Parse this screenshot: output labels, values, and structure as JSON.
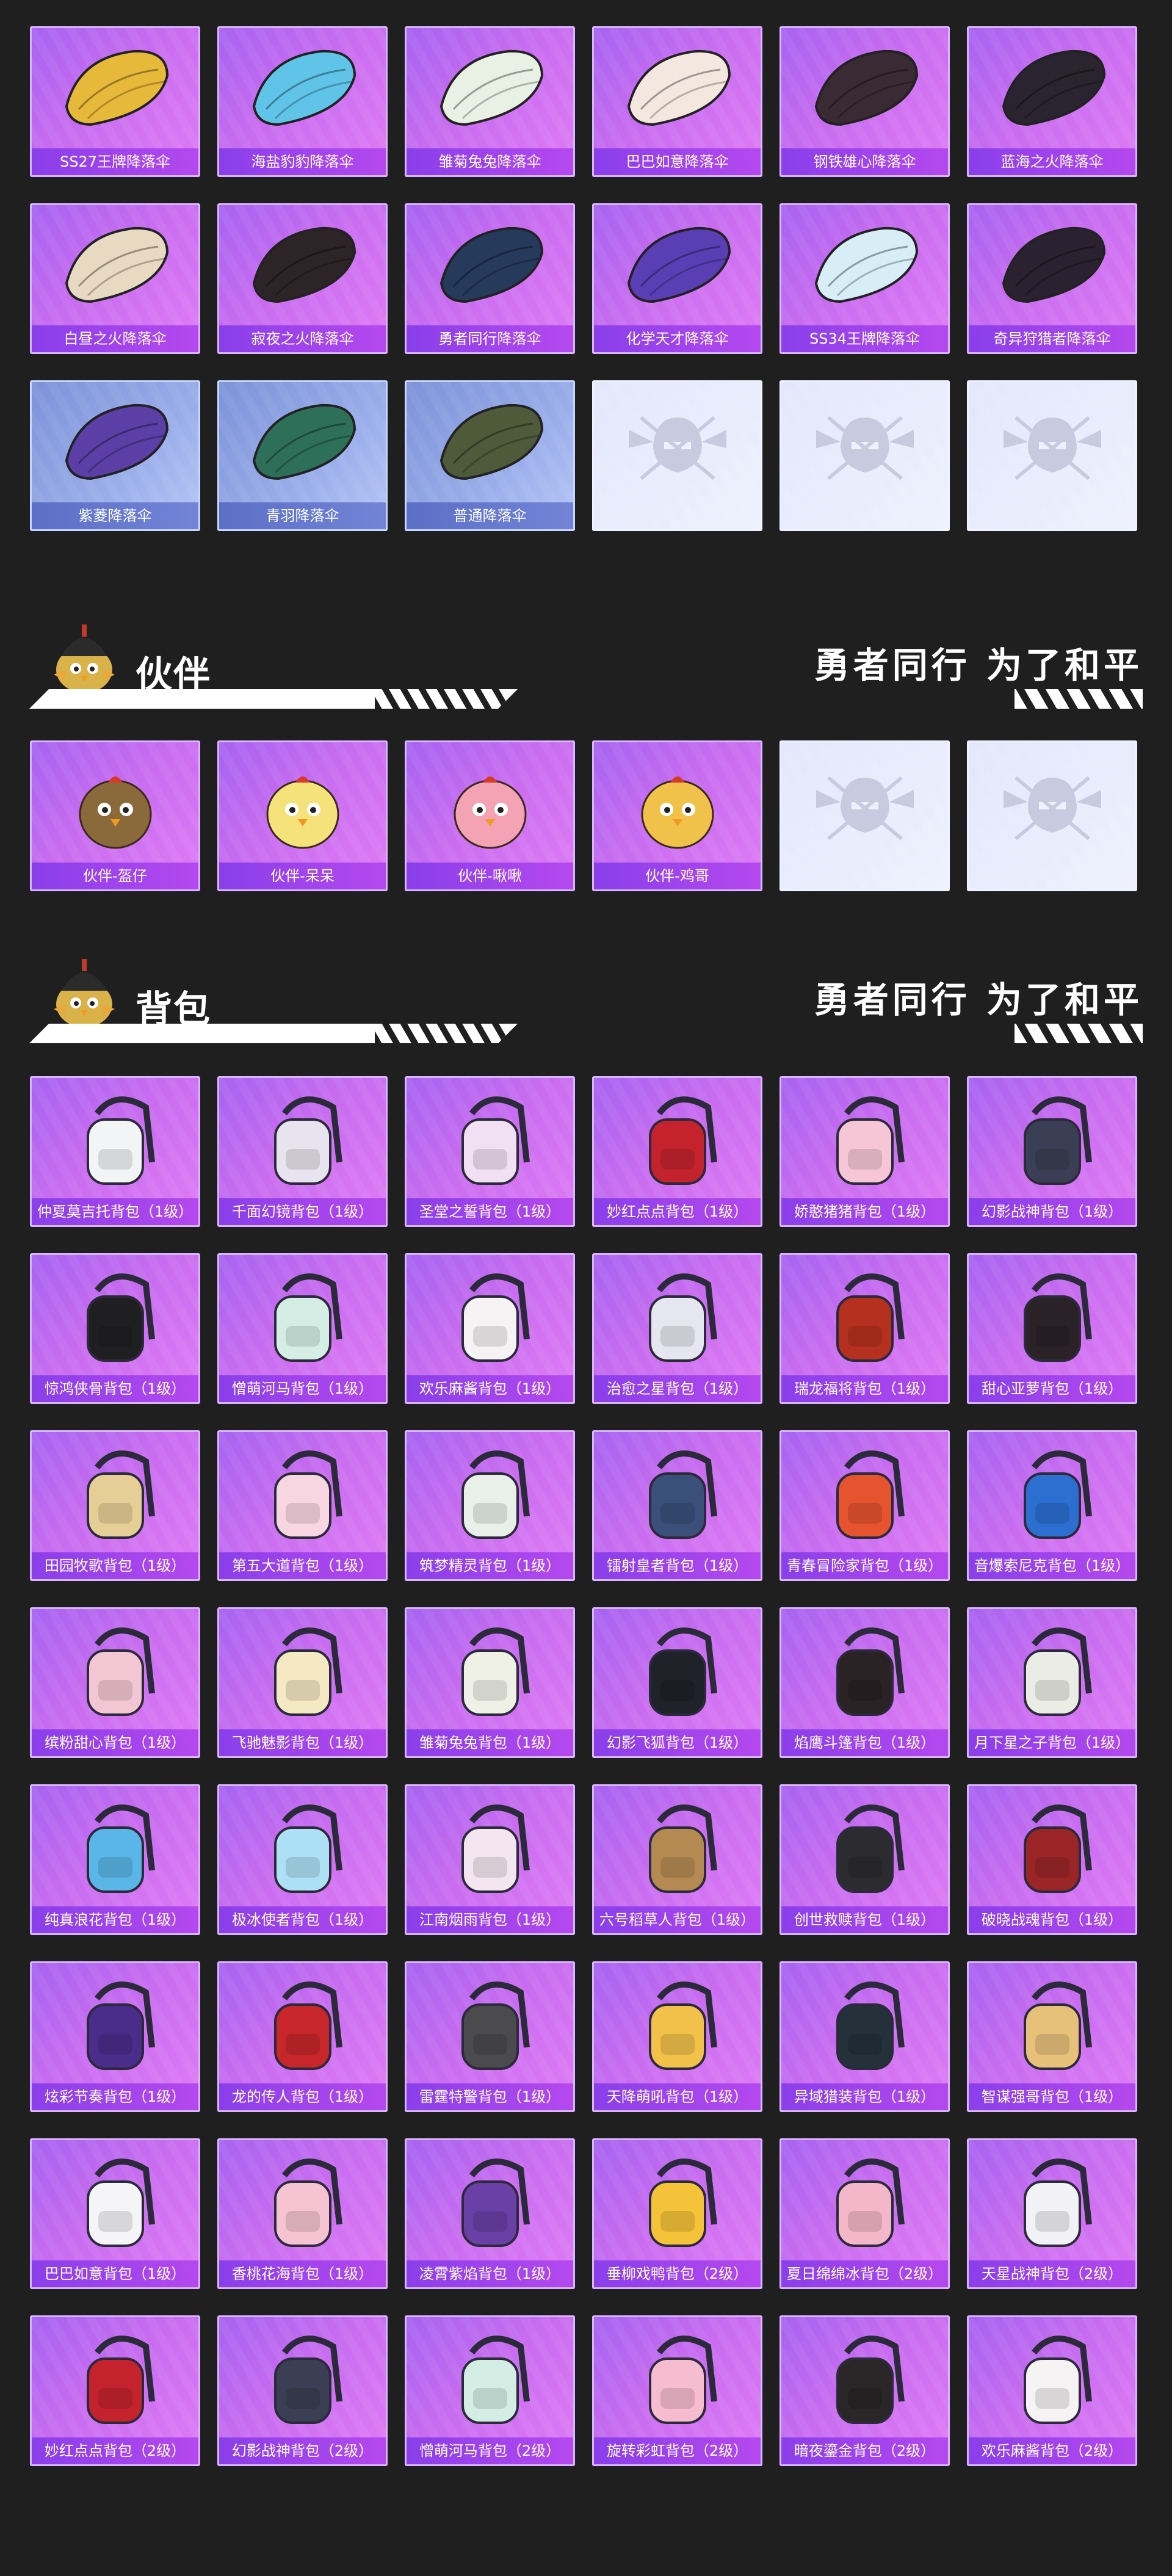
{
  "parachutes": [
    {
      "label": "SS27王牌降落伞",
      "kind": "purple",
      "icon": "parachute-icon",
      "color": "#e6b93a"
    },
    {
      "label": "海盐豹豹降落伞",
      "kind": "purple",
      "icon": "parachute-icon",
      "color": "#5fc4e8"
    },
    {
      "label": "雏菊兔兔降落伞",
      "kind": "purple",
      "icon": "parachute-icon",
      "color": "#e9f0e4"
    },
    {
      "label": "巴巴如意降落伞",
      "kind": "purple",
      "icon": "parachute-icon",
      "color": "#f3e7df"
    },
    {
      "label": "钢铁雄心降落伞",
      "kind": "purple",
      "icon": "parachute-icon",
      "color": "#3a2a33"
    },
    {
      "label": "蓝海之火降落伞",
      "kind": "purple",
      "icon": "parachute-icon",
      "color": "#2a2430"
    },
    {
      "label": "白昼之火降落伞",
      "kind": "purple",
      "icon": "parachute-icon",
      "color": "#e8d9c2"
    },
    {
      "label": "寂夜之火降落伞",
      "kind": "purple",
      "icon": "parachute-icon",
      "color": "#2d2428"
    },
    {
      "label": "勇者同行降落伞",
      "kind": "purple",
      "icon": "parachute-icon",
      "color": "#263a5c"
    },
    {
      "label": "化学天才降落伞",
      "kind": "purple",
      "icon": "parachute-icon",
      "color": "#5a3fb4"
    },
    {
      "label": "SS34王牌降落伞",
      "kind": "purple",
      "icon": "parachute-icon",
      "color": "#d7eef7"
    },
    {
      "label": "奇异狩猎者降落伞",
      "kind": "purple",
      "icon": "parachute-icon",
      "color": "#2a2230"
    },
    {
      "label": "紫菱降落伞",
      "kind": "blue",
      "icon": "parachute-icon",
      "color": "#5b3fa6"
    },
    {
      "label": "青羽降落伞",
      "kind": "blue",
      "icon": "parachute-icon",
      "color": "#2e6f5a"
    },
    {
      "label": "普通降落伞",
      "kind": "blue",
      "icon": "parachute-icon",
      "color": "#4f5a3a"
    },
    {
      "label": "",
      "kind": "placeholder",
      "icon": "pubg-emblem-icon",
      "color": "#c7cbe0"
    },
    {
      "label": "",
      "kind": "placeholder",
      "icon": "pubg-emblem-icon",
      "color": "#c7cbe0"
    },
    {
      "label": "",
      "kind": "placeholder",
      "icon": "pubg-emblem-icon",
      "color": "#c7cbe0"
    }
  ],
  "section_partner": {
    "title": "伙伴",
    "slogan": "勇者同行 为了和平",
    "mascot_icon": "helmet-chick-mascot-icon"
  },
  "partners": [
    {
      "label": "伙伴-盔仔",
      "kind": "purple",
      "icon": "companion-icon",
      "color": "#8a6a3a"
    },
    {
      "label": "伙伴-呆呆",
      "kind": "purple",
      "icon": "companion-icon",
      "color": "#f5e27a"
    },
    {
      "label": "伙伴-啾啾",
      "kind": "purple",
      "icon": "companion-icon",
      "color": "#f3a3b4"
    },
    {
      "label": "伙伴-鸡哥",
      "kind": "purple",
      "icon": "companion-icon",
      "color": "#f1c24a"
    },
    {
      "label": "",
      "kind": "placeholder",
      "icon": "pubg-emblem-icon",
      "color": "#c7cbe0"
    },
    {
      "label": "",
      "kind": "placeholder",
      "icon": "pubg-emblem-icon",
      "color": "#c7cbe0"
    }
  ],
  "section_backpack": {
    "title": "背包",
    "slogan": "勇者同行 为了和平",
    "mascot_icon": "helmet-chick-mascot-icon"
  },
  "backpacks": [
    {
      "label": "仲夏莫吉托背包（1级）",
      "kind": "purple",
      "icon": "backpack-icon",
      "color": "#f2f4f6"
    },
    {
      "label": "千面幻镜背包（1级）",
      "kind": "purple",
      "icon": "backpack-icon",
      "color": "#e8e4ef"
    },
    {
      "label": "圣堂之誓背包（1级）",
      "kind": "purple",
      "icon": "backpack-icon",
      "color": "#f1e0f3"
    },
    {
      "label": "妙红点点背包（1级）",
      "kind": "purple",
      "icon": "backpack-icon",
      "color": "#c4232e"
    },
    {
      "label": "娇憨猪猪背包（1级）",
      "kind": "purple",
      "icon": "backpack-icon",
      "color": "#f6c6d6"
    },
    {
      "label": "幻影战神背包（1级）",
      "kind": "purple",
      "icon": "backpack-icon",
      "color": "#3a3f55"
    },
    {
      "label": "惊鸿侠骨背包（1级）",
      "kind": "purple",
      "icon": "backpack-icon",
      "color": "#1f1f22"
    },
    {
      "label": "憎萌河马背包（1级）",
      "kind": "purple",
      "icon": "backpack-icon",
      "color": "#d4eee6"
    },
    {
      "label": "欢乐麻酱背包（1级）",
      "kind": "purple",
      "icon": "backpack-icon",
      "color": "#f5f3f3"
    },
    {
      "label": "治愈之星背包（1级）",
      "kind": "purple",
      "icon": "backpack-icon",
      "color": "#e5e6f0"
    },
    {
      "label": "瑞龙福将背包（1级）",
      "kind": "purple",
      "icon": "backpack-icon",
      "color": "#b5301f"
    },
    {
      "label": "甜心亚萝背包（1级）",
      "kind": "purple",
      "icon": "backpack-icon",
      "color": "#2b2228"
    },
    {
      "label": "田园牧歌背包（1级）",
      "kind": "purple",
      "icon": "backpack-icon",
      "color": "#e6cf97"
    },
    {
      "label": "第五大道背包（1级）",
      "kind": "purple",
      "icon": "backpack-icon",
      "color": "#f7d6e2"
    },
    {
      "label": "筑梦精灵背包（1级）",
      "kind": "purple",
      "icon": "backpack-icon",
      "color": "#e9efe9"
    },
    {
      "label": "镭射皇者背包（1级）",
      "kind": "purple",
      "icon": "backpack-icon",
      "color": "#3a4f7a"
    },
    {
      "label": "青春冒险家背包（1级）",
      "kind": "purple",
      "icon": "backpack-icon",
      "color": "#e5532f"
    },
    {
      "label": "音爆索尼克背包（1级）",
      "kind": "purple",
      "icon": "backpack-icon",
      "color": "#2d6fd1"
    },
    {
      "label": "缤粉甜心背包（1级）",
      "kind": "purple",
      "icon": "backpack-icon",
      "color": "#f3c6d3"
    },
    {
      "label": "飞驰魅影背包（1级）",
      "kind": "purple",
      "icon": "backpack-icon",
      "color": "#f4e9c3"
    },
    {
      "label": "雏菊兔兔背包（1级）",
      "kind": "purple",
      "icon": "backpack-icon",
      "color": "#eff1e6"
    },
    {
      "label": "幻影飞狐背包（1级）",
      "kind": "purple",
      "icon": "backpack-icon",
      "color": "#1f2228"
    },
    {
      "label": "焰鹰斗篷背包（1级）",
      "kind": "purple",
      "icon": "backpack-icon",
      "color": "#2a2224"
    },
    {
      "label": "月下星之子背包（1级）",
      "kind": "purple",
      "icon": "backpack-icon",
      "color": "#ecece6"
    },
    {
      "label": "纯真浪花背包（1级）",
      "kind": "purple",
      "icon": "backpack-icon",
      "color": "#59b6e6"
    },
    {
      "label": "极冰使者背包（1级）",
      "kind": "purple",
      "icon": "backpack-icon",
      "color": "#aee0f5"
    },
    {
      "label": "江南烟雨背包（1级）",
      "kind": "purple",
      "icon": "backpack-icon",
      "color": "#f4e6f1"
    },
    {
      "label": "六号稻草人背包（1级）",
      "kind": "purple",
      "icon": "backpack-icon",
      "color": "#b58a52"
    },
    {
      "label": "创世救赎背包（1级）",
      "kind": "purple",
      "icon": "backpack-icon",
      "color": "#2c2c30"
    },
    {
      "label": "破晓战魂背包（1级）",
      "kind": "purple",
      "icon": "backpack-icon",
      "color": "#9a2527"
    },
    {
      "label": "炫彩节奏背包（1级）",
      "kind": "purple",
      "icon": "backpack-icon",
      "color": "#4a2d8a"
    },
    {
      "label": "龙的传人背包（1级）",
      "kind": "purple",
      "icon": "backpack-icon",
      "color": "#c7262a"
    },
    {
      "label": "雷霆特警背包（1级）",
      "kind": "purple",
      "icon": "backpack-icon",
      "color": "#4b4a4d"
    },
    {
      "label": "天降萌吼背包（1级）",
      "kind": "purple",
      "icon": "backpack-icon",
      "color": "#f2c14a"
    },
    {
      "label": "异域猎装背包（1级）",
      "kind": "purple",
      "icon": "backpack-icon",
      "color": "#24313a"
    },
    {
      "label": "智谋强哥背包（1级）",
      "kind": "purple",
      "icon": "backpack-icon",
      "color": "#e7c07a"
    },
    {
      "label": "巴巴如意背包（1级）",
      "kind": "purple",
      "icon": "backpack-icon",
      "color": "#f5f5f7"
    },
    {
      "label": "香桃花海背包（1级）",
      "kind": "purple",
      "icon": "backpack-icon",
      "color": "#f6c3d2"
    },
    {
      "label": "凌霄紫焰背包（1级）",
      "kind": "purple",
      "icon": "backpack-icon",
      "color": "#6a3fa6"
    },
    {
      "label": "垂柳戏鸭背包（2级）",
      "kind": "purple",
      "icon": "backpack-icon",
      "color": "#f5c33a"
    },
    {
      "label": "夏日绵绵冰背包（2级）",
      "kind": "purple",
      "icon": "backpack-icon",
      "color": "#f4b7c9"
    },
    {
      "label": "天星战神背包（2级）",
      "kind": "purple",
      "icon": "backpack-icon",
      "color": "#f2f2f6"
    },
    {
      "label": "妙红点点背包（2级）",
      "kind": "purple",
      "icon": "backpack-icon",
      "color": "#c4232e"
    },
    {
      "label": "幻影战神背包（2级）",
      "kind": "purple",
      "icon": "backpack-icon",
      "color": "#3a3f55"
    },
    {
      "label": "憎萌河马背包（2级）",
      "kind": "purple",
      "icon": "backpack-icon",
      "color": "#d4eee6"
    },
    {
      "label": "旋转彩虹背包（2级）",
      "kind": "purple",
      "icon": "backpack-icon",
      "color": "#f6bcd0"
    },
    {
      "label": "暗夜鎏金背包（2级）",
      "kind": "purple",
      "icon": "backpack-icon",
      "color": "#2a2526"
    },
    {
      "label": "欢乐麻酱背包（2级）",
      "kind": "purple",
      "icon": "backpack-icon",
      "color": "#f5f3f3"
    }
  ]
}
